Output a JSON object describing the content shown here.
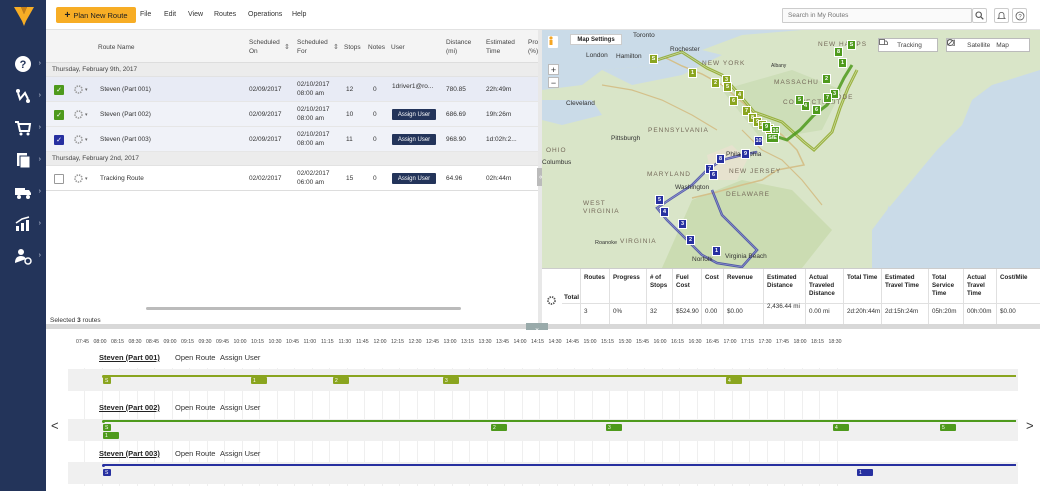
{
  "topbar": {
    "plan_button": "Plan New Route",
    "menus": [
      "File",
      "Edit",
      "View",
      "Routes",
      "Operations",
      "Help"
    ],
    "search_placeholder": "Search in My Routes"
  },
  "table": {
    "headers": {
      "route_name": "Route Name",
      "scheduled_on": "Scheduled On",
      "scheduled_for": "Scheduled For",
      "stops": "Stops",
      "notes": "Notes",
      "user": "User",
      "distance": "Distance (mi)",
      "est_time": "Estimated Time",
      "progress": "Pro (%)"
    },
    "groups": [
      {
        "label": "Thursday, February 9th, 2017"
      },
      {
        "label": "Thursday, February 2nd, 2017"
      }
    ],
    "rows": [
      {
        "name": "Steven (Part 001)",
        "on": "02/09/2017",
        "for_date": "02/10/2017",
        "for_time": "08:00 am",
        "stops": "12",
        "notes": "0",
        "user": "1driver1@ro...",
        "distance": "780.85",
        "time": "22h:49m",
        "progress": "0"
      },
      {
        "name": "Steven (Part 002)",
        "on": "02/09/2017",
        "for_date": "02/10/2017",
        "for_time": "08:00 am",
        "stops": "10",
        "notes": "0",
        "user": "Assign User",
        "distance": "686.69",
        "time": "19h:26m",
        "progress": "0"
      },
      {
        "name": "Steven (Part 003)",
        "on": "02/09/2017",
        "for_date": "02/10/2017",
        "for_time": "08:00 am",
        "stops": "11",
        "notes": "0",
        "user": "Assign User",
        "distance": "968.90",
        "time": "1d:02h:2...",
        "progress": "0"
      },
      {
        "name": "Tracking Route",
        "on": "02/02/2017",
        "for_date": "02/02/2017",
        "for_time": "06:00 am",
        "stops": "15",
        "notes": "0",
        "user": "Assign User",
        "distance": "64.96",
        "time": "02h:44m",
        "progress": "0"
      }
    ],
    "selected_prefix": "Selected ",
    "selected_count": "3",
    "selected_suffix": " routes"
  },
  "map": {
    "settings": "Map Settings",
    "tracking": "Tracking",
    "satellite": "Satellite",
    "map_label": "Map",
    "labels": [
      "Toronto",
      "London",
      "Hamilton",
      "Rochester",
      "NEW YORK",
      "Albany",
      "NEW HAMPS",
      "MASSACHU",
      "CONNECTICUT",
      "RHODE",
      "Cleveland",
      "OHIO",
      "Columbus",
      "PENNSYLVANIA",
      "Pittsburgh",
      "Philadelphia",
      "NEW JERSEY",
      "MARYLAND",
      "Washington",
      "DELAWARE",
      "WEST VIRGINIA",
      "VIRGINIA",
      "Roanoke",
      "Norfolk",
      "Virginia Beach"
    ]
  },
  "summary": {
    "total_label": "Total",
    "headers": [
      "Routes",
      "Progress",
      "# of Stops",
      "Fuel Cost",
      "Cost",
      "Revenue",
      "Estimated Distance",
      "Actual Traveled Distance",
      "Total Time",
      "Estimated Travel Time",
      "Total Service Time",
      "Actual Travel Time",
      "Cost/Mile"
    ],
    "values": [
      "3",
      "0%",
      "32",
      "$524.90",
      "0.00",
      "$0.00",
      "2,436.44 mi",
      "0.00 mi",
      "2d:20h:44m",
      "2d:15h:24m",
      "05h:20m",
      "00h:00m",
      "$0.00"
    ]
  },
  "timeline": {
    "ticks": [
      "07:45",
      "08:00",
      "08:15",
      "08:30",
      "08:45",
      "09:00",
      "09:15",
      "09:30",
      "09:45",
      "10:00",
      "10:15",
      "10:30",
      "10:45",
      "11:00",
      "11:15",
      "11:30",
      "11:45",
      "12:00",
      "12:15",
      "12:30",
      "12:45",
      "13:00",
      "13:15",
      "13:30",
      "13:45",
      "14:00",
      "14:15",
      "14:30",
      "14:45",
      "15:00",
      "15:15",
      "15:30",
      "15:45",
      "16:00",
      "16:15",
      "16:30",
      "16:45",
      "17:00",
      "17:15",
      "17:30",
      "17:45",
      "18:00",
      "18:15",
      "18:30"
    ],
    "routes": [
      {
        "name": "Steven (Part 001)",
        "open": "Open Route",
        "assign": "Assign User",
        "color": "#8aa51f",
        "stops": [
          "S",
          "1",
          "2",
          "3",
          "4"
        ]
      },
      {
        "name": "Steven (Part 002)",
        "open": "Open Route",
        "assign": "Assign User",
        "color": "#4e9a1c",
        "stops": [
          "S",
          "1",
          "2",
          "3",
          "4",
          "5"
        ]
      },
      {
        "name": "Steven (Part 003)",
        "open": "Open Route",
        "assign": "Assign User",
        "color": "#2730a0",
        "stops": [
          "S",
          "1"
        ]
      }
    ]
  },
  "colors": {
    "sidebar": "#23345a",
    "accent": "#f7ad25",
    "route1": "#8aa51f",
    "route2": "#4e9a1c",
    "route3": "#2730a0"
  }
}
